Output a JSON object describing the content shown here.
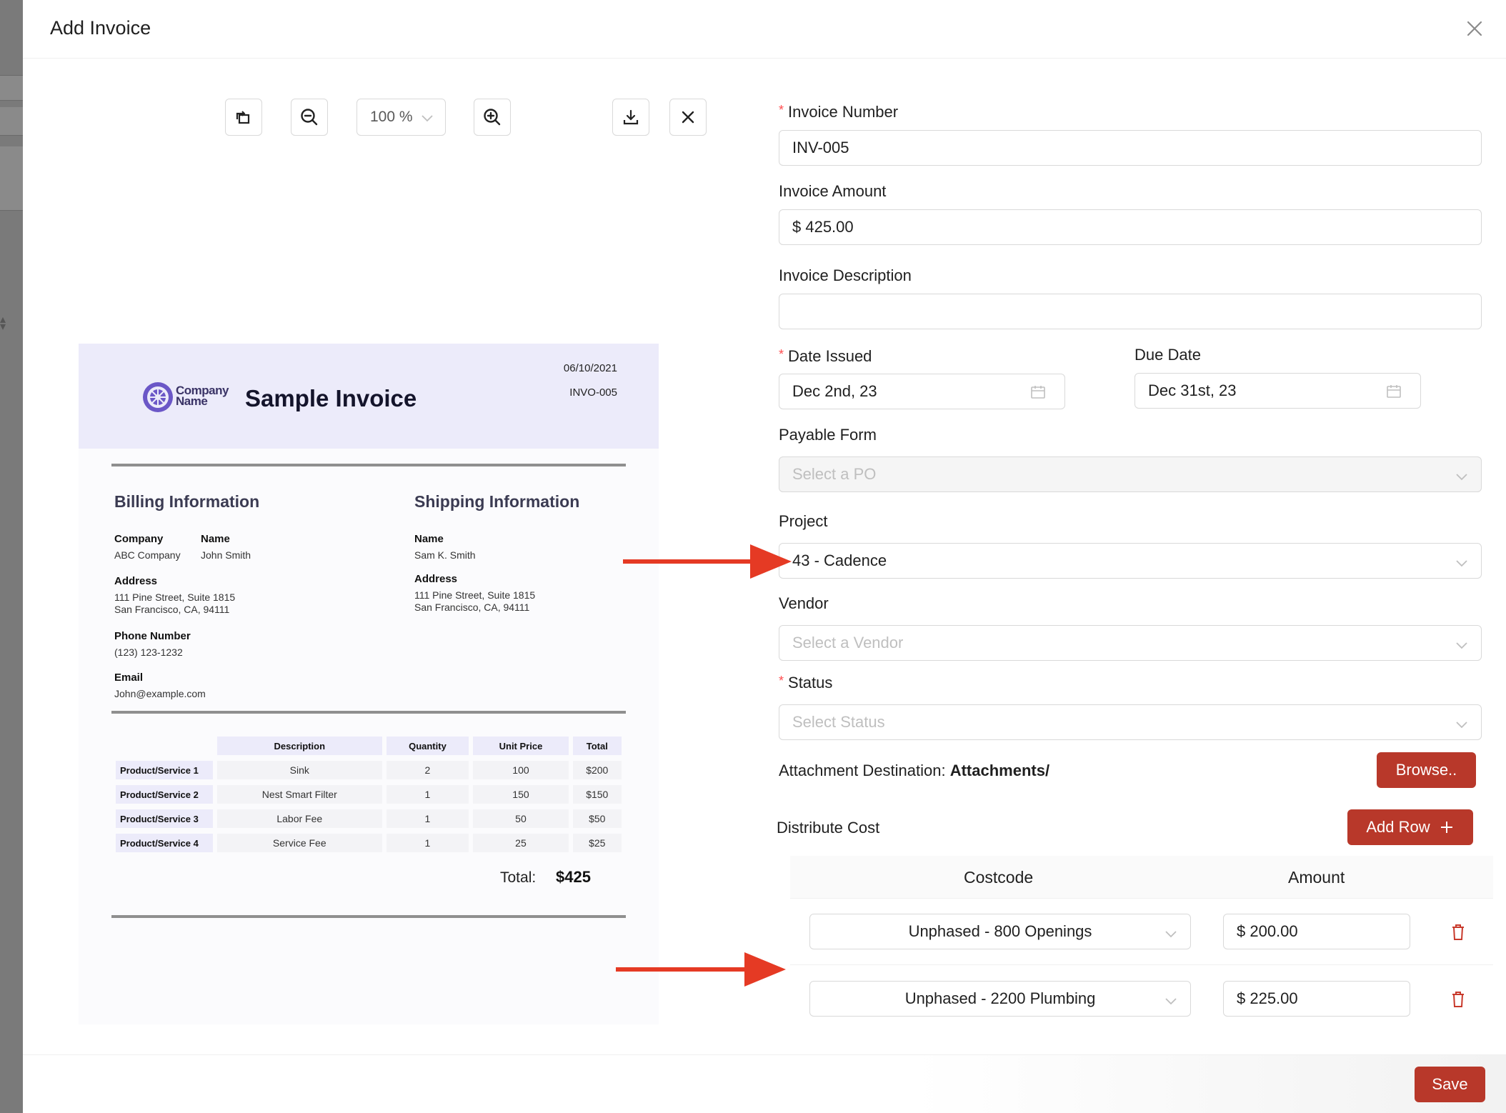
{
  "modal": {
    "title": "Add Invoice"
  },
  "toolbar": {
    "zoom_value": "100 %"
  },
  "invoice_preview": {
    "company_logo_text": [
      "Company",
      "Name"
    ],
    "title": "Sample Invoice",
    "date": "06/10/2021",
    "number": "INVO-005",
    "billing": {
      "title": "Billing Information",
      "company_label": "Company",
      "company_value": "ABC Company",
      "name_label": "Name",
      "name_value": "John Smith",
      "address_label": "Address",
      "address_line1": "111 Pine Street, Suite 1815",
      "address_line2": "San Francisco, CA, 94111",
      "phone_label": "Phone Number",
      "phone_value": "(123) 123-1232",
      "email_label": "Email",
      "email_value": "John@example.com"
    },
    "shipping": {
      "title": "Shipping Information",
      "name_label": "Name",
      "name_value": "Sam K. Smith",
      "address_label": "Address",
      "address_line1": "111 Pine Street, Suite 1815",
      "address_line2": "San Francisco, CA, 94111"
    },
    "table": {
      "headers": [
        "Description",
        "Quantity",
        "Unit Price",
        "Total"
      ],
      "rows": [
        {
          "label": "Product/Service 1",
          "description": "Sink",
          "quantity": "2",
          "unit_price": "100",
          "total": "$200"
        },
        {
          "label": "Product/Service 2",
          "description": "Nest Smart Filter",
          "quantity": "1",
          "unit_price": "150",
          "total": "$150"
        },
        {
          "label": "Product/Service 3",
          "description": "Labor Fee",
          "quantity": "1",
          "unit_price": "50",
          "total": "$50"
        },
        {
          "label": "Product/Service 4",
          "description": "Service Fee",
          "quantity": "1",
          "unit_price": "25",
          "total": "$25"
        }
      ]
    },
    "total_label": "Total:",
    "total_value": "$425"
  },
  "form": {
    "invoice_number": {
      "label": "Invoice Number",
      "value": "INV-005",
      "required": true
    },
    "invoice_amount": {
      "label": "Invoice Amount",
      "value": "$ 425.00"
    },
    "invoice_description": {
      "label": "Invoice Description",
      "value": ""
    },
    "date_issued": {
      "label": "Date Issued",
      "value": "Dec 2nd, 23",
      "required": true
    },
    "due_date": {
      "label": "Due Date",
      "value": "Dec 31st, 23"
    },
    "payable_form": {
      "label": "Payable Form",
      "placeholder": "Select a PO"
    },
    "project": {
      "label": "Project",
      "value": "43 - Cadence"
    },
    "vendor": {
      "label": "Vendor",
      "placeholder": "Select a Vendor"
    },
    "status": {
      "label": "Status",
      "placeholder": "Select Status",
      "required": true
    },
    "attachment": {
      "label": "Attachment Destination:",
      "value": "Attachments/",
      "browse_label": "Browse.."
    },
    "distribute_cost": {
      "label": "Distribute Cost",
      "add_row_label": "Add Row",
      "col_costcode": "Costcode",
      "col_amount": "Amount",
      "rows": [
        {
          "costcode": "Unphased - 800 Openings",
          "amount": "$ 200.00"
        },
        {
          "costcode": "Unphased - 2200 Plumbing",
          "amount": "$ 225.00"
        }
      ]
    }
  },
  "footer": {
    "save_label": "Save"
  },
  "colors": {
    "primary_red": "#b8382a",
    "arrow_red": "#e53a24",
    "invoice_header_bg": "#ecebfa"
  }
}
